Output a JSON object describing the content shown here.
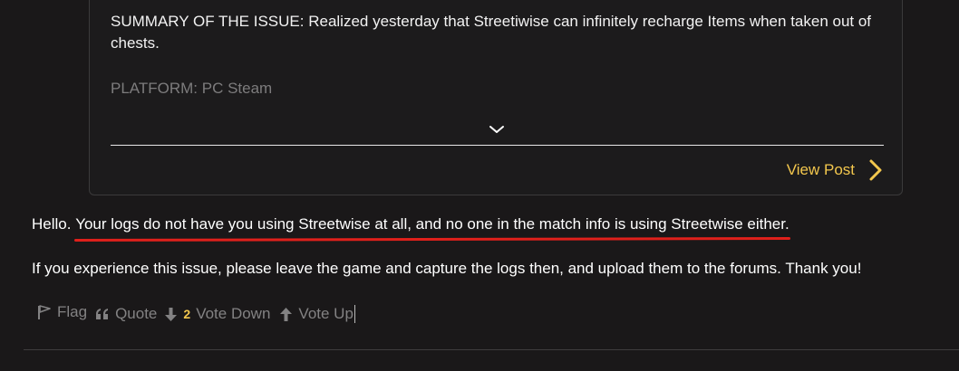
{
  "quote": {
    "summary": "SUMMARY OF THE ISSUE: Realized yesterday that Streetiwise can infinitely recharge Items when taken out of chests.",
    "platform": "PLATFORM: PC Steam",
    "view_post_label": "View Post",
    "expand_icon": "chevron-down-icon",
    "view_post_icon": "chevron-right-icon"
  },
  "post": {
    "greeting": "Hello. ",
    "highlighted": "Your logs do not have you using Streetwise at all, and no one in the match info is using Streetwise either.",
    "paragraph2": "If you experience this issue, please leave the game and capture the logs then, and upload them to the forums. Thank you!",
    "highlight_color": "#e0201b"
  },
  "actions": {
    "flag_label": "Flag",
    "quote_label": "Quote",
    "vote_count": "2",
    "vote_down_label": "Vote Down",
    "vote_up_label": "Vote Up"
  },
  "colors": {
    "background": "#1a1819",
    "accent": "#f3c74d",
    "muted_text": "#838283"
  }
}
